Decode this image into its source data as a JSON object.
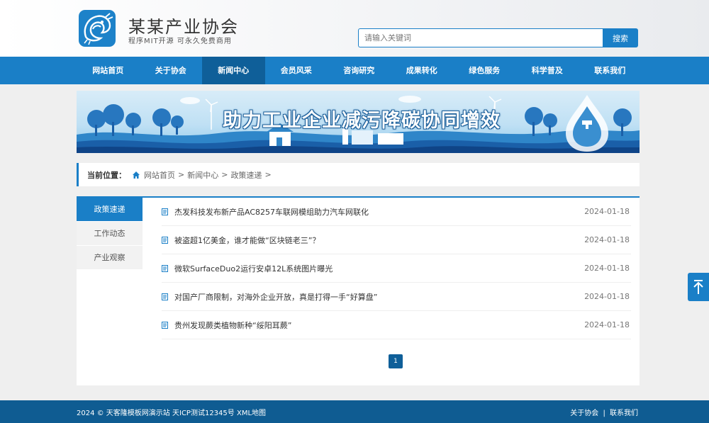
{
  "header": {
    "title": "某某产业协会",
    "subtitle": "程序MIT开源 可永久免费商用"
  },
  "search": {
    "placeholder": "请输入关键词",
    "button_label": "搜索"
  },
  "nav": {
    "items": [
      {
        "label": "网站首页"
      },
      {
        "label": "关于协会"
      },
      {
        "label": "新闻中心"
      },
      {
        "label": "会员风采"
      },
      {
        "label": "咨询研究"
      },
      {
        "label": "成果转化"
      },
      {
        "label": "绿色服务"
      },
      {
        "label": "科学普及"
      },
      {
        "label": "联系我们"
      }
    ],
    "active": "新闻中心"
  },
  "banner": {
    "title": "助力工业企业减污降碳协同增效"
  },
  "breadcrumb": {
    "label": "当前位置：",
    "items": [
      "网站首页",
      "新闻中心",
      "政策速递"
    ],
    "separator": ">"
  },
  "sidebar": {
    "items": [
      {
        "label": "政策速递"
      },
      {
        "label": "工作动态"
      },
      {
        "label": "产业观察"
      }
    ],
    "active": "政策速递"
  },
  "articles": [
    {
      "title": "杰发科技发布新产品AC8257车联网模组助力汽车网联化",
      "date": "2024-01-18"
    },
    {
      "title": "被盗超1亿美金，谁才能做“区块链老三”？",
      "date": "2024-01-18"
    },
    {
      "title": "微软SurfaceDuo2运行安卓12L系统图片曝光",
      "date": "2024-01-18"
    },
    {
      "title": "对国产厂商限制，对海外企业开放，真是打得一手“好算盘”",
      "date": "2024-01-18"
    },
    {
      "title": "贵州发现蕨类植物新种“绥阳耳蕨”",
      "date": "2024-01-18"
    }
  ],
  "pagination": {
    "current": "1"
  },
  "footer": {
    "copyright": "2024 © 天客隆模板网演示站",
    "icp": "天ICP测试12345号",
    "sitemap": "XML地图",
    "links": [
      "关于协会",
      "联系我们"
    ],
    "link_separator": "|"
  },
  "colors": {
    "primary": "#1a7fc7",
    "primary_dark": "#0f5f99",
    "footer": "#0f5c92"
  },
  "icons": {
    "logo": "dragon-logo-icon",
    "home": "home-icon",
    "doc": "document-icon",
    "backtop": "arrow-up-to-top-icon"
  }
}
